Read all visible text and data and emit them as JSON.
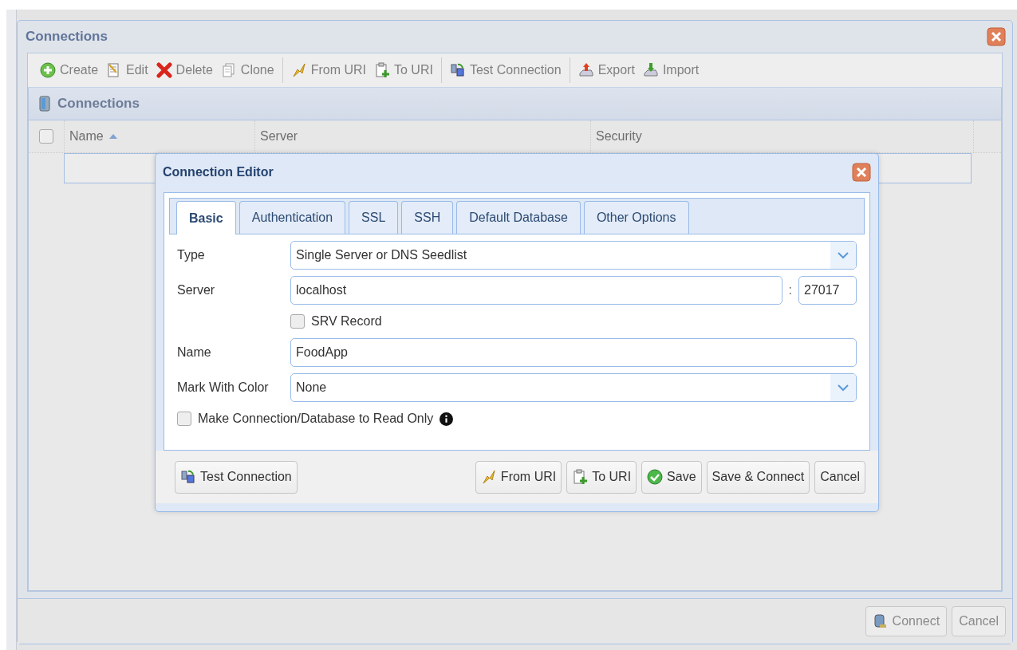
{
  "window": {
    "title": "Connections"
  },
  "toolbar_groups": [
    [
      {
        "label": "Create"
      },
      {
        "label": "Edit"
      },
      {
        "label": "Delete"
      },
      {
        "label": "Clone"
      }
    ],
    [
      {
        "label": "From URI"
      },
      {
        "label": "To URI"
      }
    ],
    [
      {
        "label": "Test Connection"
      }
    ],
    [
      {
        "label": "Export"
      },
      {
        "label": "Import"
      }
    ]
  ],
  "grid": {
    "title": "Connections",
    "select_all_checked": false,
    "columns": [
      {
        "label": "Name",
        "sorted": true
      },
      {
        "label": "Server",
        "sorted": false
      },
      {
        "label": "Security",
        "sorted": false
      }
    ]
  },
  "footer_buttons": [
    {
      "label": "Connect"
    },
    {
      "label": "Cancel"
    }
  ],
  "editor": {
    "title": "Connection Editor",
    "tabs": [
      {
        "label": "Basic",
        "selected": true
      },
      {
        "label": "Authentication",
        "selected": false
      },
      {
        "label": "SSL",
        "selected": false
      },
      {
        "label": "SSH",
        "selected": false
      },
      {
        "label": "Default Database",
        "selected": false
      },
      {
        "label": "Other Options",
        "selected": false
      }
    ],
    "fields": [
      {
        "kind": "select",
        "label": "Type",
        "value": "Single Server or DNS Seedlist"
      },
      {
        "kind": "server",
        "label": "Server",
        "value": "localhost",
        "separator": ":",
        "port": "27017"
      },
      {
        "kind": "option",
        "label": "SRV Record",
        "checked": false
      },
      {
        "kind": "text",
        "label": "Name",
        "value": "FoodApp"
      },
      {
        "kind": "select",
        "label": "Mark With Color",
        "value": "None"
      },
      {
        "kind": "checkbox",
        "label": "Make Connection/Database to Read Only",
        "checked": false,
        "info": true
      }
    ],
    "left_buttons": [
      {
        "label": "Test Connection"
      }
    ],
    "right_buttons": [
      {
        "label": "From URI"
      },
      {
        "label": "To URI"
      },
      {
        "label": "Save"
      },
      {
        "label": "Save & Connect"
      },
      {
        "label": "Cancel"
      }
    ]
  }
}
